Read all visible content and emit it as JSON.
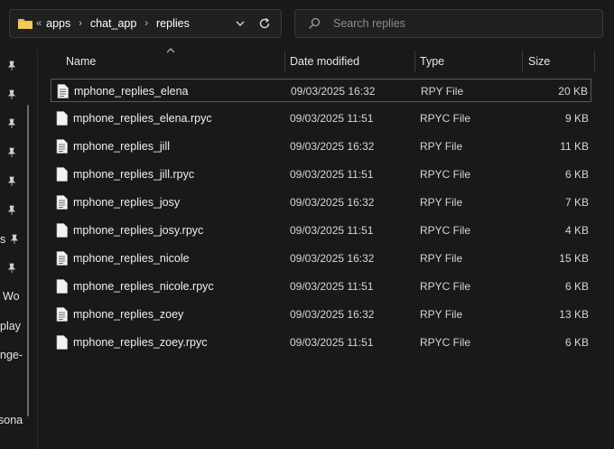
{
  "address": {
    "overflow": "«",
    "crumbs": [
      "apps",
      "chat_app",
      "replies"
    ]
  },
  "search": {
    "placeholder": "Search replies"
  },
  "nav": {
    "texts": [
      "s",
      "Wo",
      "play",
      "nge-",
      "sona"
    ]
  },
  "columns": {
    "name": "Name",
    "date": "Date modified",
    "type": "Type",
    "size": "Size"
  },
  "files": [
    {
      "name": "mphone_replies_elena",
      "date": "09/03/2025 16:32",
      "type": "RPY File",
      "size": "20 KB"
    },
    {
      "name": "mphone_replies_elena.rpyc",
      "date": "09/03/2025 11:51",
      "type": "RPYC File",
      "size": "9 KB"
    },
    {
      "name": "mphone_replies_jill",
      "date": "09/03/2025 16:32",
      "type": "RPY File",
      "size": "11 KB"
    },
    {
      "name": "mphone_replies_jill.rpyc",
      "date": "09/03/2025 11:51",
      "type": "RPYC File",
      "size": "6 KB"
    },
    {
      "name": "mphone_replies_josy",
      "date": "09/03/2025 16:32",
      "type": "RPY File",
      "size": "7 KB"
    },
    {
      "name": "mphone_replies_josy.rpyc",
      "date": "09/03/2025 11:51",
      "type": "RPYC File",
      "size": "4 KB"
    },
    {
      "name": "mphone_replies_nicole",
      "date": "09/03/2025 16:32",
      "type": "RPY File",
      "size": "15 KB"
    },
    {
      "name": "mphone_replies_nicole.rpyc",
      "date": "09/03/2025 11:51",
      "type": "RPYC File",
      "size": "6 KB"
    },
    {
      "name": "mphone_replies_zoey",
      "date": "09/03/2025 16:32",
      "type": "RPY File",
      "size": "13 KB"
    },
    {
      "name": "mphone_replies_zoey.rpyc",
      "date": "09/03/2025 11:51",
      "type": "RPYC File",
      "size": "6 KB"
    }
  ],
  "icons": {
    "folder": "folder-icon",
    "dropdown": "chevron-down-icon",
    "refresh": "refresh-icon",
    "search": "search-icon",
    "pin": "pin-icon",
    "file": "file-icon",
    "sort": "sort-ascending-icon"
  },
  "colors": {
    "background": "#191919",
    "folder": "#e8b84a",
    "text": "#e6e6e6"
  }
}
